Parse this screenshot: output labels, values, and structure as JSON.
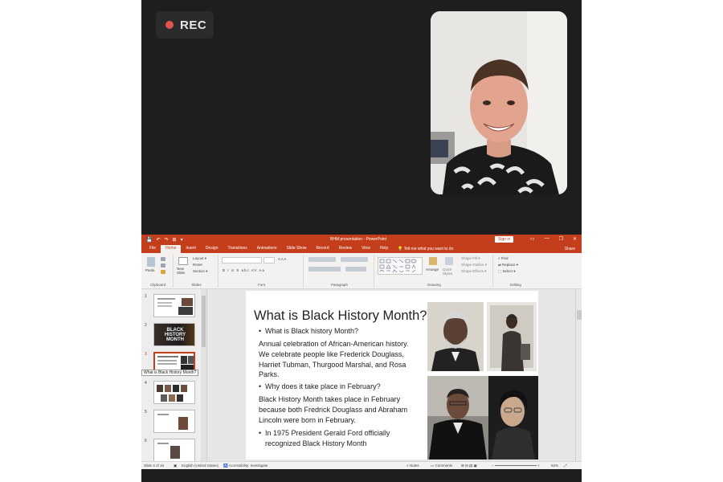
{
  "recording": {
    "label": "REC",
    "dot_color": "#e0554b"
  },
  "video": {
    "participant_alt": "participant webcam"
  },
  "powerpoint": {
    "accent_color": "#c43e1c",
    "titlebar": {
      "quick_access": [
        "💾",
        "↶",
        "↷",
        "⊞",
        "▾"
      ],
      "document_title": "BHM presentation  -  PowerPoint",
      "sign_in": "Sign in",
      "window_controls": [
        "▭",
        "—",
        "❐",
        "✕"
      ]
    },
    "tabs": [
      "File",
      "Home",
      "Insert",
      "Design",
      "Transitions",
      "Animations",
      "Slide Show",
      "Record",
      "Review",
      "View",
      "Help"
    ],
    "active_tab": "Home",
    "tell_me": "Tell me what you want to do",
    "share": "Share",
    "ribbon": {
      "clipboard": {
        "label": "Clipboard",
        "paste": "Paste"
      },
      "slides": {
        "label": "Slides",
        "new_slide": "New Slide",
        "layout": "Layout ▾",
        "reset": "Reset",
        "section": "Section ▾"
      },
      "font": {
        "label": "Font",
        "buttons": "B  I  U  S  abc  AV  Aa"
      },
      "paragraph": {
        "label": "Paragraph"
      },
      "drawing": {
        "label": "Drawing",
        "arrange": "Arrange",
        "quick_styles": "Quick Styles",
        "shape_fill": "Shape Fill ▾",
        "shape_outline": "Shape Outline ▾",
        "shape_effects": "Shape Effects ▾"
      },
      "editing": {
        "label": "Editing",
        "find": "Find",
        "replace": "Replace ▾",
        "select": "Select ▾"
      }
    },
    "thumbnails": {
      "numbers": [
        "1",
        "2",
        "3",
        "4",
        "5",
        "6"
      ],
      "slide2_text": "BLACK HISTORY MONTH",
      "tooltip": "What is  Black History Month?"
    },
    "slide": {
      "title": "What is  Black History Month?",
      "bullet1": "What is Black history Month?",
      "para1": "Annual celebration of African-American history. We celebrate people like Frederick Douglass, Harriet Tubman, Thurgood Marshal, and Rosa Parks.",
      "bullet2": "Why does it take place in February?",
      "para2": "Black History Month takes place in February because both Fredrick Douglass and Abraham Lincoln were born in February.",
      "bullet3": "In 1975 President Gerald Ford officially recognized Black History Month"
    },
    "status": {
      "slide_of": "Slide 3 of 16",
      "language": "English (United States)",
      "accessibility": "Accessibility: Investigate",
      "notes": "Notes",
      "comments": "Comments",
      "zoom": "62%"
    }
  }
}
